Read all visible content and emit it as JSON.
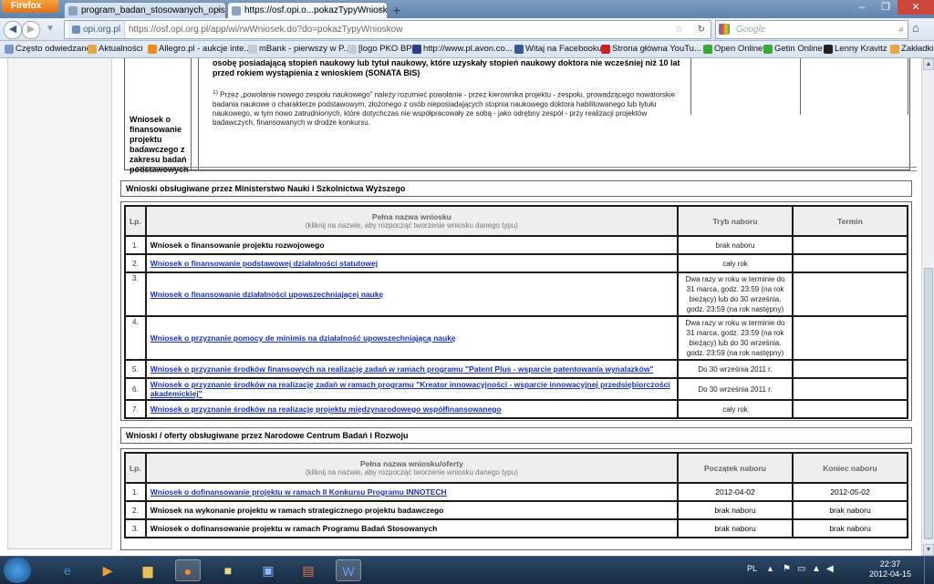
{
  "browser": {
    "menu_label": "Firefox",
    "tabs": [
      {
        "title": "program_badan_stosowanych_opis_1...",
        "close": "×"
      },
      {
        "title": "https://osf.opi.o...pokazTypyWnioskow",
        "close": "×"
      }
    ],
    "new_tab": "+",
    "window_controls": {
      "min": "–",
      "max": "❐",
      "close": "✕"
    },
    "url_site": "opi.org.pl",
    "url": "https://osf.opi.org.pl/app/wi/rwWniosek.do?do=pokazTypyWnioskow",
    "search_placeholder": "Google",
    "bookmarks": [
      "Często odwiedzane",
      "Aktualności",
      "Allegro.pl - aukcje inte...",
      "mBank - pierwszy w P...",
      "[logo PKO BP]",
      "http://www.pl.avon.co...",
      "Witaj na Facebooku!",
      "Strona główna YouTu...",
      "Open Online",
      "Getin Online",
      "Lenny Kravitz",
      "Zakładki"
    ]
  },
  "top_section": {
    "row_label": "Wniosek o finansowanie projektu badawczego z zakresu badań podstawowych",
    "bold_text": "osobę posiadającą stopień naukowy lub tytuł naukowy, które uzyskały stopień naukowy doktora nie wcześniej niż 10 lat przed rokiem wystąpienia z wnioskiem (SONATA BIS)",
    "footnote_marker": "1)",
    "footnote": "Przez „powołanie nowego zespołu naukowego” należy rozumieć powołanie - przez kierownika projektu - zespołu, prowadzącego nowatorskie badania naukowe o charakterze podstawowym, złożonego z osób nieposiadających stopnia naukowego doktora habilitowanego lub tytułu naukowego, w tym nowo zatrudnionych, które dotychczas nie współpracowały ze sobą - jako odrębny zespół - przy realizacji projektów badawczych, finansowanych w drodze konkursu."
  },
  "mnisw": {
    "header": "Wnioski obsługiwane przez Ministerstwo Nauki i Szkolnictwa Wyższego",
    "columns": {
      "lp": "Lp.",
      "name": "Pełna nazwa wniosku",
      "name_hint": "(kliknij na nazwie, aby rozpocząć tworzenie wniosku danego typu)",
      "mode": "Tryb naboru",
      "term": "Termin"
    },
    "rows": [
      {
        "lp": "1.",
        "name": "Wniosek o finansowanie projektu rozwojowego",
        "mode": "brak naboru",
        "term": ""
      },
      {
        "lp": "2.",
        "name": "Wniosek o finansowanie podstawowej działalności statutowej",
        "mode": "cały rok",
        "term": ""
      },
      {
        "lp": "3.",
        "name": "Wniosek o finansowanie działalności upowszechniającej naukę",
        "mode": "Dwa razy w roku w terminie do 31 marca, godz. 23:59 (na rok bieżący) lub do 30 września. godz. 23:59 (na rok następny)",
        "term": ""
      },
      {
        "lp": "4.",
        "name": "Wniosek o przyznanie pomocy de minimis na działalność upowszechniającą naukę",
        "mode": "Dwa razy w roku w terminie do 31 marca, godz. 23:59 (na rok bieżący) lub do 30 września. godz. 23:59 (na rok następny)",
        "term": ""
      },
      {
        "lp": "5.",
        "name": "Wniosek o przyznanie środków finansowych na realizację zadań w ramach programu \"Patent Plus - wsparcie patentowania wynalazków\"",
        "mode": "Do 30 września 2011 r.",
        "term": ""
      },
      {
        "lp": "6.",
        "name": "Wniosek o przyznanie środków na realizację zadań w ramach programu \"Kreator innowacyjności - wsparcie innowacyjnej przedsiębiorczości akademickiej\"",
        "mode": "Do 30 września 2011 r.",
        "term": ""
      },
      {
        "lp": "7.",
        "name": "Wniosek o przyznanie środków na realizację projektu międzynarodowego współfinansowanego",
        "mode": "cały rok",
        "term": ""
      }
    ]
  },
  "ncbr": {
    "header": "Wnioski / oferty obsługiwane przez Narodowe Centrum Badań i Rozwoju",
    "columns": {
      "lp": "Lp.",
      "name": "Pełna nazwa wniosku/oferty",
      "name_hint": "(kliknij na nazwie, aby rozpocząć tworzenie wniosku danego typu)",
      "start": "Początek naboru",
      "end": "Koniec naboru"
    },
    "rows": [
      {
        "lp": "1.",
        "name": "Wniosek o dofinansowanie projektu w ramach II Konkursu Programu INNOTECH",
        "start": "2012-04-02",
        "end": "2012-05-02"
      },
      {
        "lp": "2.",
        "name": "Wniosek na wykonanie projektu w ramach strategicznego projektu badawczego",
        "start": "brak naboru",
        "end": "brak naboru"
      },
      {
        "lp": "3.",
        "name": "Wniosek o dofinansowanie projektu w ramach Programu Badań Stosowanych",
        "start": "brak naboru",
        "end": "brak naboru"
      }
    ]
  },
  "taskbar": {
    "lang": "PL",
    "time": "22:37",
    "date": "2012-04-15"
  }
}
